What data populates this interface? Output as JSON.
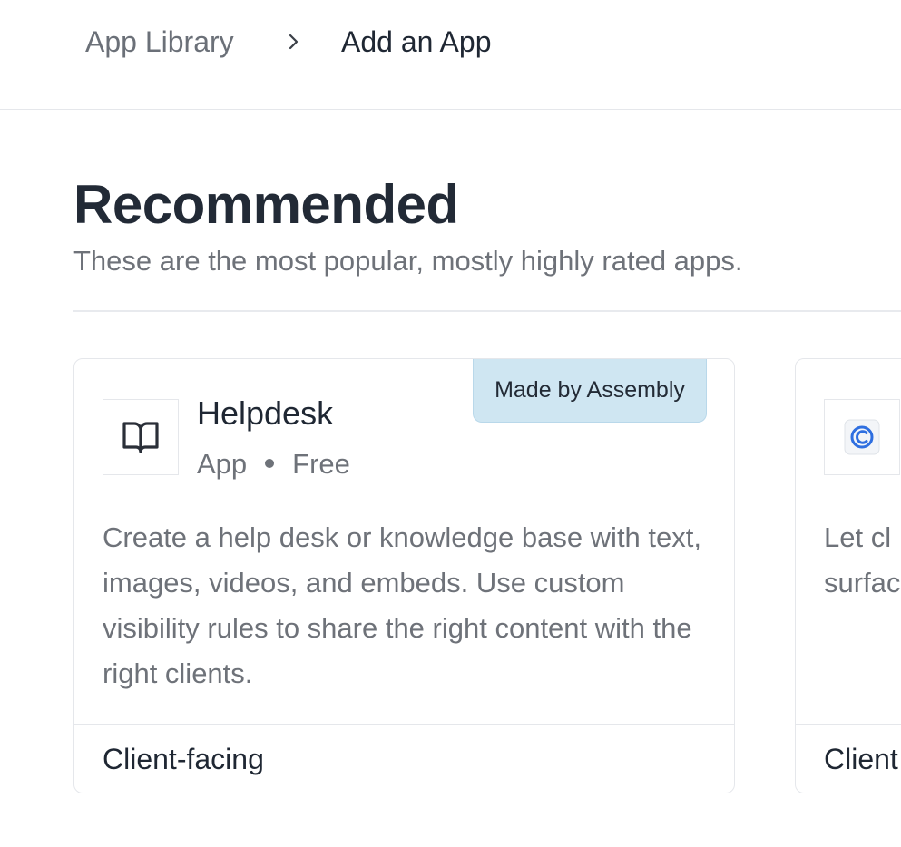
{
  "breadcrumb": {
    "parent": "App Library",
    "current": "Add an App"
  },
  "section": {
    "title": "Recommended",
    "subtitle": "These are the most popular, mostly highly rated apps."
  },
  "cards": [
    {
      "title": "Helpdesk",
      "type": "App",
      "price": "Free",
      "badge": "Made by Assembly",
      "description": "Create a help desk or knowledge base with text, images, videos, and embeds. Use custom visibility rules to share the right content with the right clients.",
      "tag": "Client-facing",
      "icon": "book-icon"
    },
    {
      "description_lines": [
        "Let cl",
        "surfac"
      ],
      "tag": "Client",
      "icon": "calendly-logo-icon",
      "accent": "#2f6fe0"
    }
  ],
  "colors": {
    "badge_bg": "#cfe6f2",
    "text_primary": "#1f2733",
    "text_secondary": "#6e7279"
  }
}
